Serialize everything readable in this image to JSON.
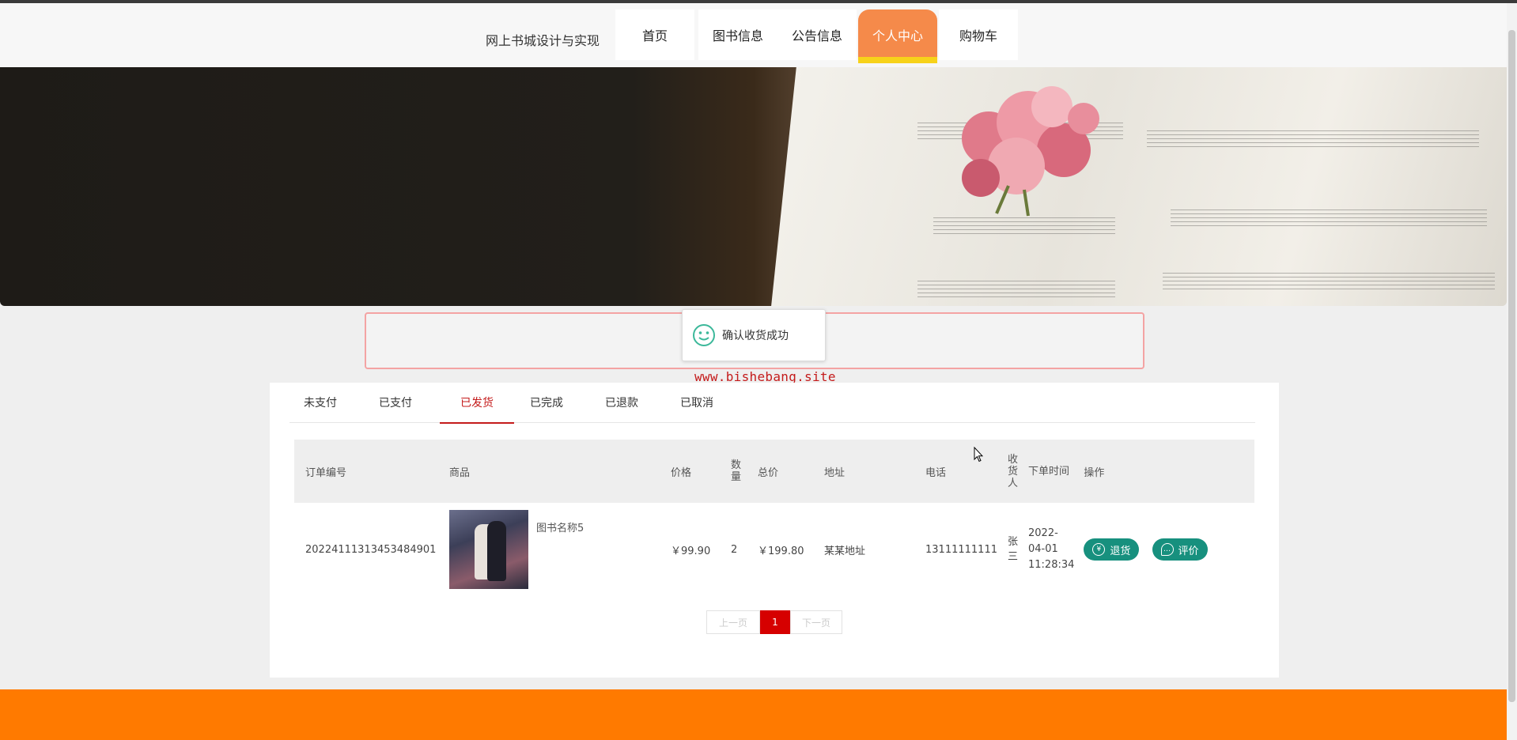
{
  "header": {
    "site_title": "网上书城设计与实现",
    "nav": [
      {
        "label": "首页"
      },
      {
        "label": "图书信息"
      },
      {
        "label": "公告信息"
      },
      {
        "label": "个人中心",
        "active": true
      },
      {
        "label": "购物车"
      }
    ]
  },
  "banner": {
    "slide_count": 3,
    "active_slide": 2
  },
  "toast": {
    "message": "确认收货成功",
    "icon": "smile-icon"
  },
  "watermark": "www.bishebang.site",
  "orders": {
    "tabs": [
      {
        "label": "未支付"
      },
      {
        "label": "已支付"
      },
      {
        "label": "已发货",
        "active": true
      },
      {
        "label": "已完成"
      },
      {
        "label": "已退款"
      },
      {
        "label": "已取消"
      }
    ],
    "columns": {
      "order_no": "订单编号",
      "product": "商品",
      "price": "价格",
      "quantity": "数量",
      "total": "总价",
      "address": "地址",
      "phone": "电话",
      "receiver": "收货人",
      "order_time": "下单时间",
      "actions": "操作"
    },
    "rows": [
      {
        "order_no": "20224111313453484901",
        "product_name": "图书名称5",
        "price": "￥99.90",
        "quantity": "2",
        "total": "￥199.80",
        "address": "某某地址",
        "phone": "13111111111",
        "receiver": "张三",
        "order_time": "2022-04-01 11:28:34",
        "actions": [
          {
            "label": "退货",
            "icon": "yen-icon"
          },
          {
            "label": "评价",
            "icon": "comment-icon"
          }
        ]
      }
    ]
  },
  "pagination": {
    "prev": "上一页",
    "current": "1",
    "next": "下一页"
  },
  "colors": {
    "accent": "#f58a4a",
    "active_tab": "#c41b1b",
    "button": "#17907e",
    "footer": "#ff7a00"
  }
}
